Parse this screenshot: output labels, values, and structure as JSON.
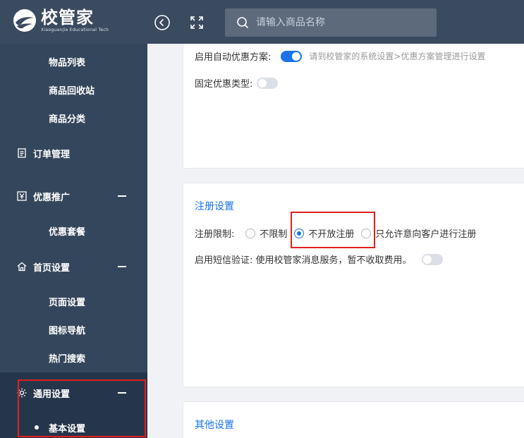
{
  "header": {
    "logo_title": "校管家",
    "logo_subtitle": "Xiaoguanjia Educational Tech",
    "search_placeholder": "请输入商品名称",
    "collapse_icon": "chevron-left-icon",
    "fullscreen_icon": "fullscreen-icon",
    "search_icon": "search-icon"
  },
  "sidebar": {
    "items": [
      {
        "label": "物品列表",
        "level": "sub"
      },
      {
        "label": "商品回收站",
        "level": "sub"
      },
      {
        "label": "商品分类",
        "level": "sub"
      },
      {
        "label": "订单管理",
        "level": "group",
        "icon": "clipboard-icon"
      },
      {
        "label": "优惠推广",
        "level": "group",
        "icon": "discount-icon",
        "expanded": true
      },
      {
        "label": "优惠套餐",
        "level": "sub"
      },
      {
        "label": "首页设置",
        "level": "group",
        "icon": "home-icon",
        "expanded": true
      },
      {
        "label": "页面设置",
        "level": "sub"
      },
      {
        "label": "图标导航",
        "level": "sub"
      },
      {
        "label": "热门搜索",
        "level": "sub"
      },
      {
        "label": "通用设置",
        "level": "group",
        "icon": "gear-icon",
        "expanded": true,
        "active": true
      },
      {
        "label": "基本设置",
        "level": "sub",
        "active": true
      }
    ]
  },
  "discount_card": {
    "auto_discount_label": "启用自动优惠方案:",
    "auto_discount_on": true,
    "auto_discount_hint": "请到校管家的系统设置>优惠方案管理进行设置",
    "fixed_discount_label": "固定优惠类型:",
    "fixed_discount_on": false
  },
  "register_card": {
    "title": "注册设置",
    "limit_label": "注册限制:",
    "options": [
      "不限制",
      "不开放注册",
      "只允许意向客户进行注册"
    ],
    "selected": "不开放注册",
    "sms_label": "启用短信验证: 使用校管家消息服务，暂不收取费用。",
    "sms_on": false
  },
  "other_card": {
    "title": "其他设置"
  },
  "colors": {
    "header_bg": "#3a4a5f",
    "sidebar_bg": "#34465b",
    "accent": "#1a73e8",
    "highlight": "#e02020"
  }
}
